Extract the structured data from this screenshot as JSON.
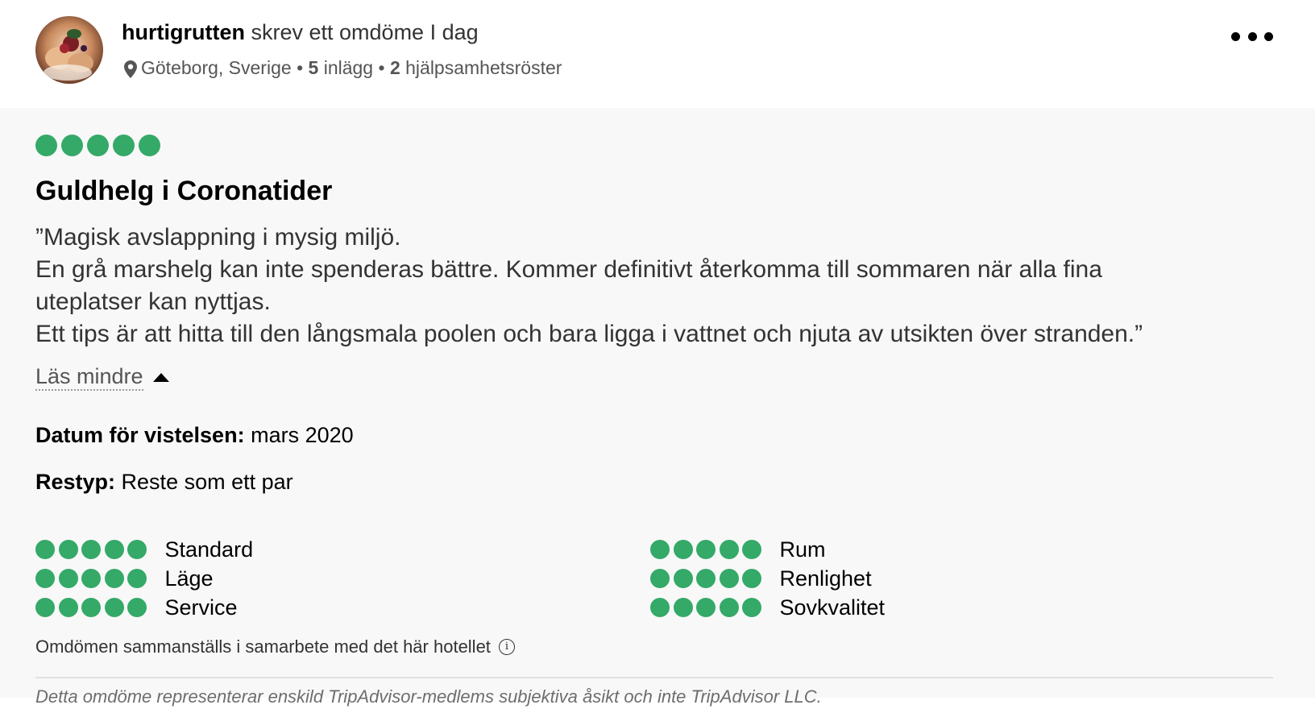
{
  "review": {
    "author": {
      "username": "hurtigrutten",
      "action_text": "skrev ett omdöme I dag",
      "location": "Göteborg, Sverige",
      "posts_count": "5",
      "posts_label": "inlägg",
      "votes_count": "2",
      "votes_label": "hjälpsamhetsröster",
      "separator": "•"
    },
    "rating": 5,
    "title": "Guldhelg i Coronatider",
    "text_lines": [
      "”Magisk avslappning i mysig miljö.",
      "En grå marshelg kan inte spenderas bättre. Kommer definitivt återkomma till sommaren när alla fina",
      "uteplatser kan nyttjas.",
      "Ett tips är att hitta till den långsmala poolen och bara ligga i vattnet och njuta av utsikten över stranden.”"
    ],
    "read_less_label": "Läs mindre",
    "stay_date_label": "Datum för vistelsen:",
    "stay_date_value": "mars 2020",
    "trip_type_label": "Restyp:",
    "trip_type_value": "Reste som ett par",
    "sub_ratings": [
      {
        "label": "Standard",
        "rating": 5
      },
      {
        "label": "Läge",
        "rating": 5
      },
      {
        "label": "Service",
        "rating": 5
      },
      {
        "label": "Rum",
        "rating": 5
      },
      {
        "label": "Renlighet",
        "rating": 5
      },
      {
        "label": "Sovkvalitet",
        "rating": 5
      }
    ],
    "disclaimer": "Omdömen sammanställs i samarbete med det här hotellet",
    "footer_cut_text": "Detta omdöme representerar enskild TripAdvisor-medlems subjektiva åsikt och inte TripAdvisor LLC."
  },
  "colors": {
    "bubble": "#34a968",
    "panel_background": "#f8f8f8"
  },
  "icons": {
    "location": "map-pin-icon",
    "more": "more-options-icon",
    "info": "info-icon",
    "collapse": "caret-up-icon"
  }
}
